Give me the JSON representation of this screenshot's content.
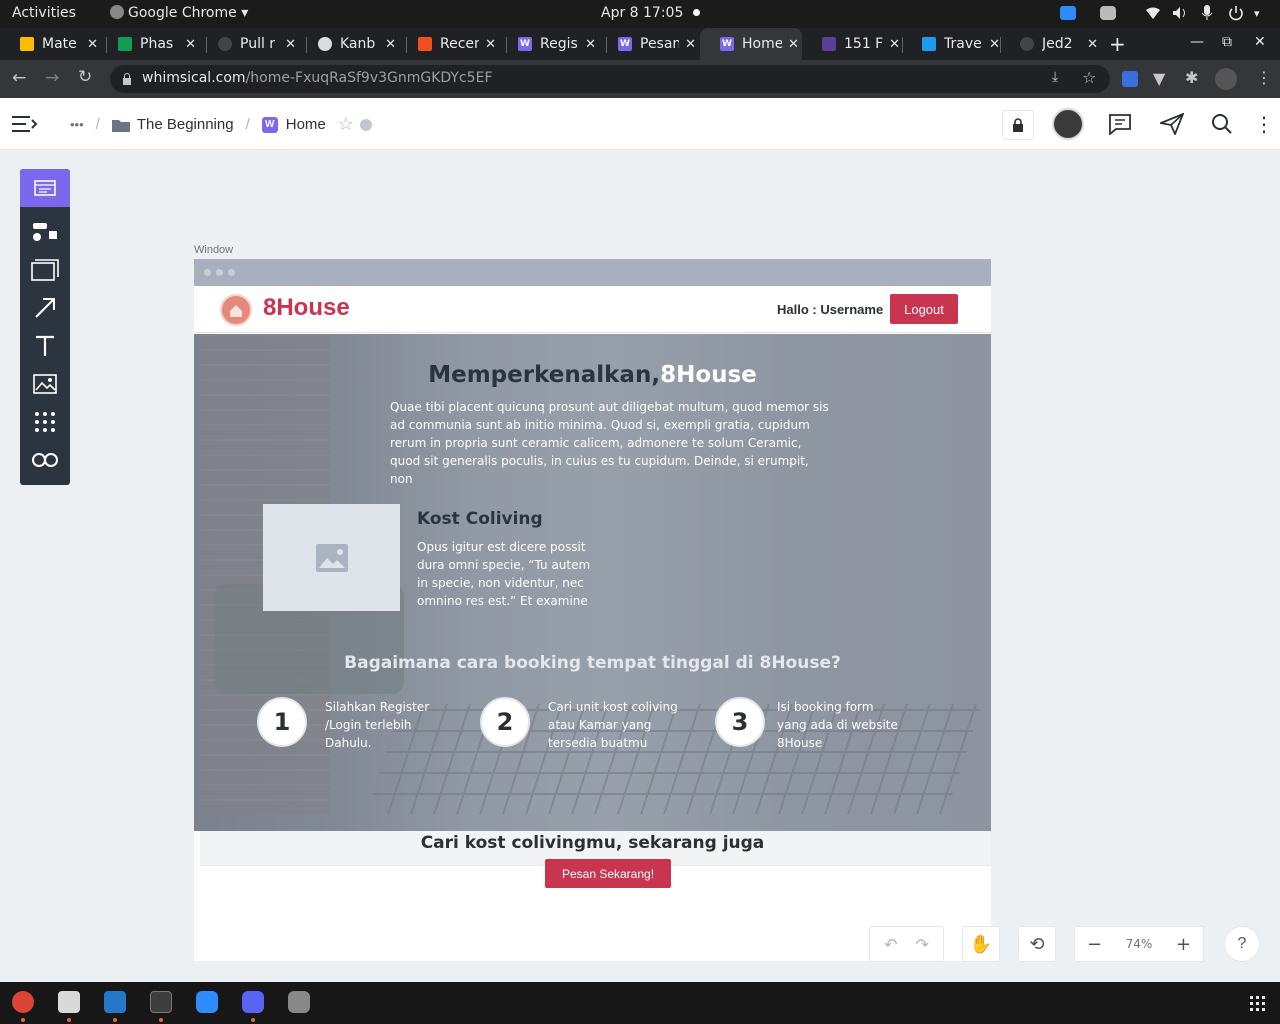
{
  "os": {
    "activities": "Activities",
    "app_menu": "Google Chrome",
    "clock": "Apr 8  17:05"
  },
  "tabs": [
    {
      "label": "Mate",
      "color": "#fbbc04",
      "icon": "google-drive-icon"
    },
    {
      "label": "Phas",
      "color": "#0f9d58",
      "icon": "sheets-icon"
    },
    {
      "label": "Pull r",
      "color": "#24292f",
      "icon": "github-icon"
    },
    {
      "label": "Kanb",
      "color": "#5f6368",
      "icon": "globe-icon"
    },
    {
      "label": "Recen",
      "color": "#f24e1e",
      "icon": "figma-icon"
    },
    {
      "label": "Regis",
      "color": "#7b68ee",
      "icon": "whimsical-icon"
    },
    {
      "label": "Pesan",
      "color": "#7b68ee",
      "icon": "whimsical-icon"
    },
    {
      "label": "Home",
      "color": "#7b68ee",
      "icon": "whimsical-icon",
      "active": true
    },
    {
      "label": "151 F",
      "color": "#5b3e96",
      "icon": "coolors-icon"
    },
    {
      "label": "Trave",
      "color": "#1d9bf0",
      "icon": "bird-icon"
    },
    {
      "label": "Jed2",
      "color": "#24292f",
      "icon": "github-icon"
    }
  ],
  "address": {
    "host": "whimsical.com",
    "path": "/home-FxuqRaSf9v3GnmGKDYc5EF"
  },
  "header": {
    "more": "•••",
    "folder": "The Beginning",
    "board": "Home",
    "board_icon": "W"
  },
  "wireframe": {
    "label": "Window",
    "brand": "8House",
    "greeting": "Hallo : Username",
    "logout": "Logout",
    "hero_title_a": "Memperkenalkan,",
    "hero_title_b": "8House",
    "hero_body": "Quae tibi placent quicunq prosunt aut diligebat multum, quod memor sis ad communia sunt ab initio minima. Quod si, exempli gratia, cupidum rerum in propria sunt ceramic calicem, admonere te solum Ceramic, quod sit generalis poculis, in cuius es tu cupidum. Deinde, si erumpit, non",
    "kost_title": "Kost Coliving",
    "kost_body": "Opus igitur est dicere possit dura omni specie, “Tu autem in specie, non videntur, nec omnino res est.” Et examine",
    "how_title": "Bagaimana cara booking tempat tinggal di 8House?",
    "steps": [
      {
        "n": "1",
        "text": "Silahkan Register /Login terlebih Dahulu."
      },
      {
        "n": "2",
        "text": "Cari unit kost coliving atau Kamar yang tersedia buatmu"
      },
      {
        "n": "3",
        "text": "Isi booking form yang ada di website 8House"
      }
    ],
    "cta_title": "Cari kost colivingmu, sekarang juga",
    "cta_button": "Pesan Sekarang!"
  },
  "controls": {
    "zoom": "74%",
    "help": "?"
  },
  "colors": {
    "accent": "#7b68ee",
    "brand": "#c9344f"
  }
}
